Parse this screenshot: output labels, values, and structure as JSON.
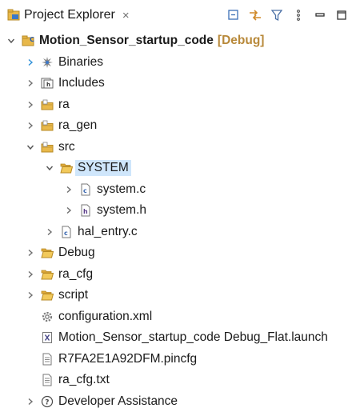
{
  "view": {
    "tab_title": "Project Explorer",
    "tab_icon": "project-explorer-icon",
    "close_glyph": "×",
    "toolbar_icons": [
      "collapse-all-icon",
      "link-with-editor-icon",
      "filter-icon",
      "view-menu-icon",
      "minimize-icon",
      "maximize-icon"
    ]
  },
  "tree": {
    "project": {
      "name": "Motion_Sensor_startup_code",
      "suffix": "[Debug]",
      "expanded": true
    },
    "items": [
      {
        "label": "Binaries",
        "icon": "binaries-icon",
        "expandable": true,
        "expanded": false,
        "depth": 1
      },
      {
        "label": "Includes",
        "icon": "includes-icon",
        "expandable": true,
        "expanded": false,
        "depth": 1
      },
      {
        "label": "ra",
        "icon": "source-folder-icon",
        "expandable": true,
        "expanded": false,
        "depth": 1
      },
      {
        "label": "ra_gen",
        "icon": "source-folder-icon",
        "expandable": true,
        "expanded": false,
        "depth": 1
      },
      {
        "label": "src",
        "icon": "source-folder-icon",
        "expandable": true,
        "expanded": true,
        "depth": 1
      },
      {
        "label": "SYSTEM",
        "icon": "folder-icon",
        "expandable": true,
        "expanded": true,
        "depth": 2,
        "selected": true
      },
      {
        "label": "system.c",
        "icon": "c-file-icon",
        "expandable": true,
        "expanded": false,
        "depth": 3
      },
      {
        "label": "system.h",
        "icon": "h-file-icon",
        "expandable": true,
        "expanded": false,
        "depth": 3
      },
      {
        "label": "hal_entry.c",
        "icon": "c-file-icon",
        "expandable": true,
        "expanded": false,
        "depth": 2
      },
      {
        "label": "Debug",
        "icon": "folder-icon",
        "expandable": true,
        "expanded": false,
        "depth": 1
      },
      {
        "label": "ra_cfg",
        "icon": "folder-icon",
        "expandable": true,
        "expanded": false,
        "depth": 1
      },
      {
        "label": "script",
        "icon": "folder-icon",
        "expandable": true,
        "expanded": false,
        "depth": 1
      },
      {
        "label": "configuration.xml",
        "icon": "configuration-icon",
        "expandable": false,
        "depth": 1
      },
      {
        "label": "Motion_Sensor_startup_code Debug_Flat.launch",
        "icon": "launch-file-icon",
        "expandable": false,
        "depth": 1
      },
      {
        "label": "R7FA2E1A92DFM.pincfg",
        "icon": "text-file-icon",
        "expandable": false,
        "depth": 1
      },
      {
        "label": "ra_cfg.txt",
        "icon": "text-file-icon",
        "expandable": false,
        "depth": 1
      },
      {
        "label": "Developer Assistance",
        "icon": "help-icon",
        "expandable": true,
        "expanded": false,
        "depth": 1
      }
    ]
  },
  "colors": {
    "selection": "#cfe6fb",
    "folder": "#e8b84a",
    "project_suffix": "#b8893a",
    "chevron": "#6e6e6e",
    "c_file": "#3c68b0"
  }
}
